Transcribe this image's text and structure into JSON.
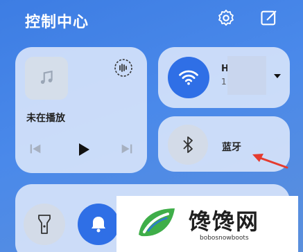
{
  "header": {
    "title": "控制中心"
  },
  "media": {
    "status": "未在播放"
  },
  "wifi": {
    "name": "H",
    "sub": "1"
  },
  "bluetooth": {
    "label": "蓝牙"
  },
  "watermark": {
    "text": "馋馋网",
    "url": "bobosnowboots"
  },
  "colors": {
    "accent": "#2f6fe6",
    "arrow": "#e53b2f"
  },
  "icons": {
    "settings": "gear-icon",
    "edit": "edit-icon",
    "music": "music-note-icon",
    "cast": "audio-cast-icon",
    "prev": "skip-previous-icon",
    "play": "play-icon",
    "next": "skip-next-icon",
    "wifi": "wifi-icon",
    "dropdown": "triangle-down-icon",
    "bluetooth": "bluetooth-icon",
    "torch": "flashlight-icon",
    "bell": "bell-icon"
  }
}
